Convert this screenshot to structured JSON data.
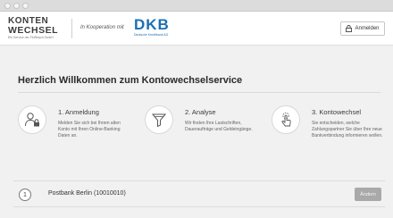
{
  "brand": {
    "logo_line1": "KONTEN",
    "logo_line2": "WECHSEL",
    "logo_sub": "Ein Service der FinReach GmbH",
    "cooperation": "In Kooperation mit",
    "partner_logo": "DKB",
    "partner_sub": "Deutsche Kreditbank AG"
  },
  "header": {
    "login_label": "Anmelden",
    "login_icon": "lock-icon"
  },
  "main": {
    "title": "Herzlich Willkommen zum Kontowechselservice",
    "steps": [
      {
        "title": "1. Anmeldung",
        "text": "Melden Sie sich bei Ihrem alten Konto mit Ihren Online-Banking Daten an.",
        "icon": "user-lock-icon"
      },
      {
        "title": "2. Analyse",
        "text": "Wir finden Ihre Lastschriften, Daueraufträge und Geldeingänge.",
        "icon": "filter-icon"
      },
      {
        "title": "3. Kontowechsel",
        "text": "Sie entscheiden, welche Zahlungspartner Sie über Ihre neue Bankverbindung informieren wollen.",
        "icon": "hand-pointer-icon"
      }
    ]
  },
  "bank_row": {
    "number": "1",
    "bank_name": "Postbank Berlin (10010010)",
    "change_label": "Ändern"
  },
  "colors": {
    "dkb_blue": "#1a6fb3",
    "background": "#f1f1f1",
    "button_grey": "#a9a9a9"
  }
}
